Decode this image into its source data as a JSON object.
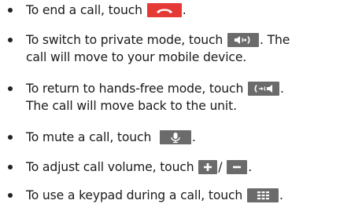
{
  "items": [
    {
      "text_before": "To end a call, touch",
      "text_after": ".",
      "icon": "end-call-icon",
      "icon_color": "#e53935"
    },
    {
      "text_before": "To switch to private mode, touch",
      "text_after": ". The",
      "continuation": "call will move to your mobile device.",
      "icon": "private-mode-icon",
      "icon_color": "#6b6b6b"
    },
    {
      "text_before": "To return to hands-free mode, touch",
      "text_after": ".",
      "continuation": "The call will move back to the unit.",
      "icon": "hands-free-mode-icon",
      "icon_color": "#6b6b6b"
    },
    {
      "text_before": "To mute a call, touch",
      "text_after": ".",
      "icon": "microphone-icon",
      "icon_color": "#6b6b6b"
    },
    {
      "text_before": "To adjust call volume, touch",
      "separator": "/",
      "text_after": ".",
      "icon": "volume-up-icon",
      "icon_2": "volume-down-icon",
      "icon_color": "#6b6b6b"
    },
    {
      "text_before": "To use a keypad during a call, touch",
      "text_after": ".",
      "icon": "keypad-icon",
      "icon_color": "#6b6b6b"
    }
  ]
}
